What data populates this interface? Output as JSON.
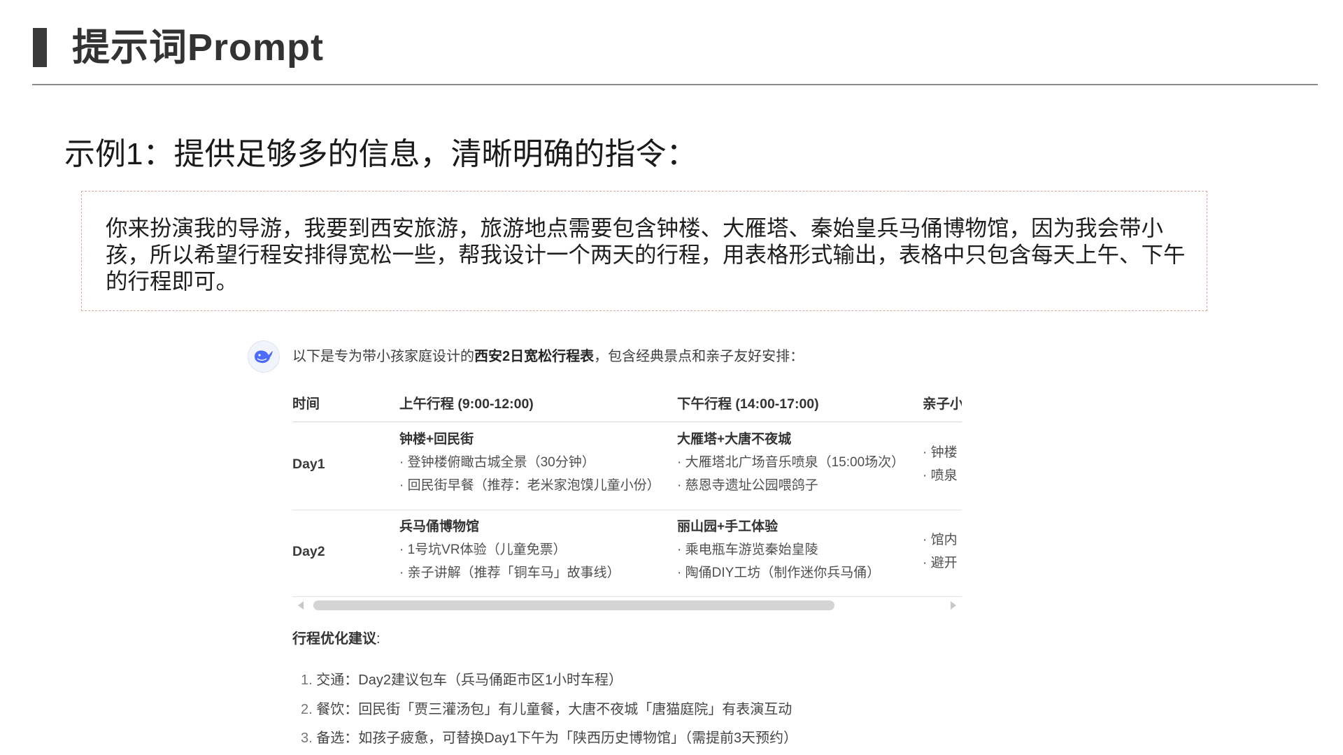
{
  "slide": {
    "title": "提示词Prompt",
    "example_heading": "示例1：提供足够多的信息，清晰明确的指令：",
    "prompt_text": "你来扮演我的导游，我要到西安旅游，旅游地点需要包含钟楼、大雁塔、秦始皇兵马俑博物馆，因为我会带小孩，所以希望行程安排得宽松一些，帮我设计一个两天的行程，用表格形式输出，表格中只包含每天上午、下午的行程即可。"
  },
  "response": {
    "avatar_icon": "whale-logo-icon",
    "intro_before": "以下是专为带小孩家庭设计的",
    "intro_bold": "西安2日宽松行程表",
    "intro_after": "，包含经典景点和亲子友好安排：",
    "table": {
      "headers": [
        "时间",
        "上午行程 (9:00-12:00)",
        "下午行程 (14:00-17:00)",
        "亲子小"
      ],
      "rows": [
        {
          "day": "Day1",
          "morning": {
            "title": "钟楼+回民街",
            "items": [
              "· 登钟楼俯瞰古城全景（30分钟）",
              "· 回民街早餐（推荐：老米家泡馍儿童小份）"
            ]
          },
          "afternoon": {
            "title": "大雁塔+大唐不夜城",
            "items": [
              "· 大雁塔北广场音乐喷泉（15:00场次）",
              "· 慈恩寺遗址公园喂鸽子"
            ]
          },
          "tips": [
            "· 钟楼",
            "· 喷泉"
          ]
        },
        {
          "day": "Day2",
          "morning": {
            "title": "兵马俑博物馆",
            "items": [
              "· 1号坑VR体验（儿童免票）",
              "· 亲子讲解（推荐「铜车马」故事线）"
            ]
          },
          "afternoon": {
            "title": "丽山园+手工体验",
            "items": [
              "· 乘电瓶车游览秦始皇陵",
              "· 陶俑DIY工坊（制作迷你兵马俑）"
            ]
          },
          "tips": [
            "· 馆内",
            "· 避开"
          ]
        }
      ]
    },
    "suggestions_title": "行程优化建议",
    "suggestions_colon": ":",
    "suggestions": [
      {
        "num": "1.",
        "text": "交通：Day2建议包车（兵马俑距市区1小时车程）"
      },
      {
        "num": "2.",
        "text": "餐饮：回民街「贾三灌汤包」有儿童餐，大唐不夜城「唐猫庭院」有表演互动"
      },
      {
        "num": "3.",
        "text": "备选：如孩子疲惫，可替换Day1下午为「陕西历史博物馆」（需提前3天预约）"
      }
    ]
  }
}
